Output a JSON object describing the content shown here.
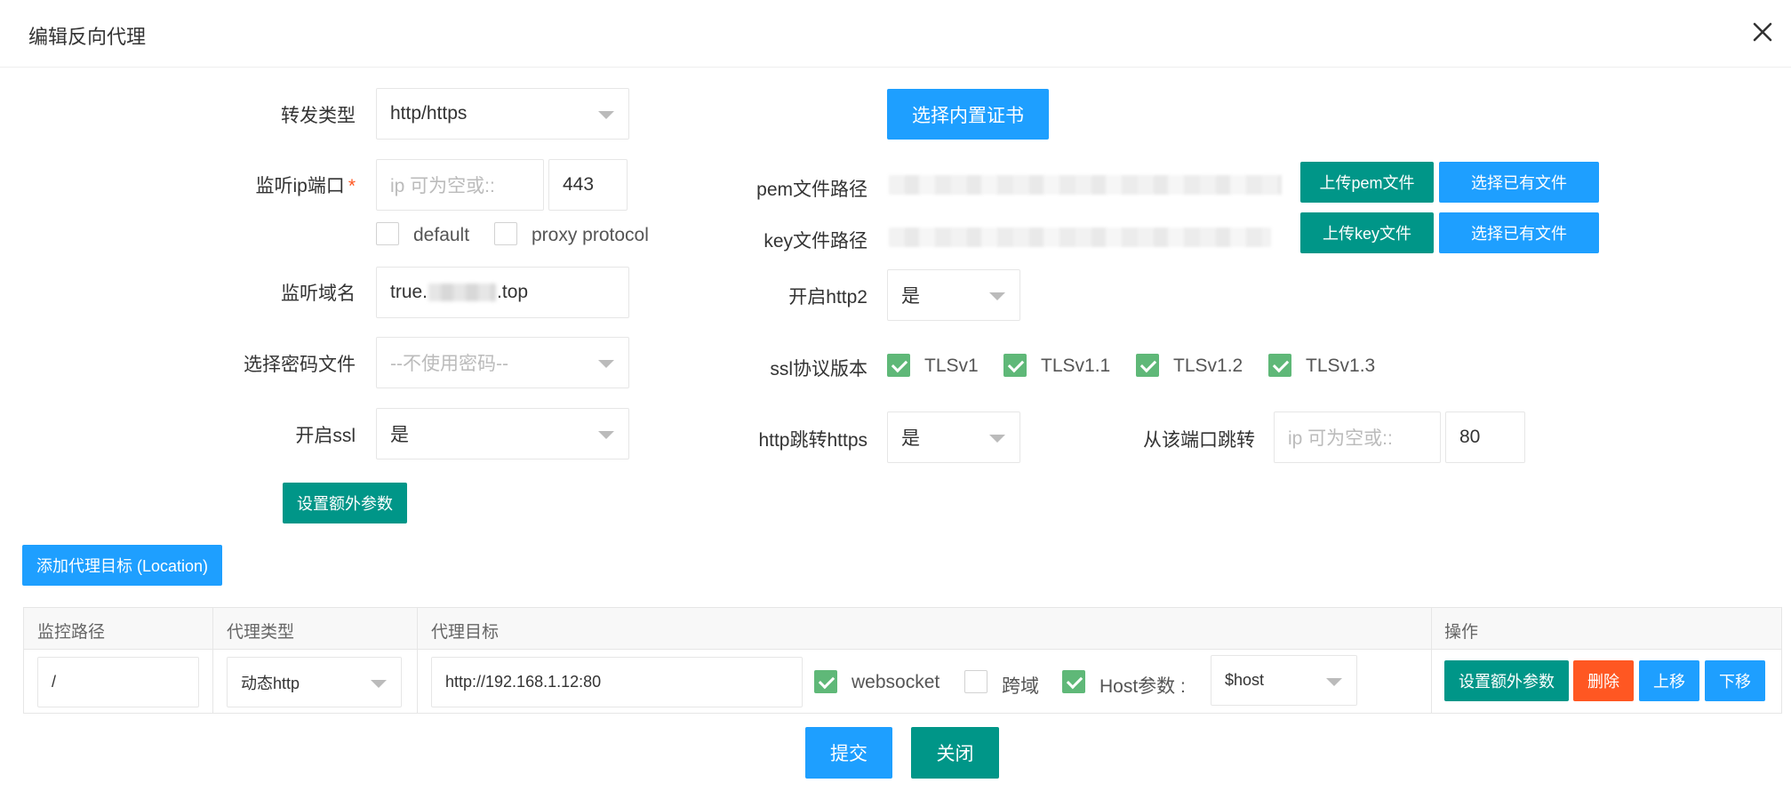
{
  "dialog": {
    "title": "编辑反向代理"
  },
  "form_left": {
    "forward_type": {
      "label": "转发类型",
      "value": "http/https"
    },
    "listen_ip_port": {
      "label": "监听ip端口",
      "required_mark": "*",
      "ip_placeholder": "ip 可为空或::",
      "port_value": "443"
    },
    "options": {
      "default_label": "default",
      "default_checked": false,
      "proxy_protocol_label": "proxy protocol",
      "proxy_protocol_checked": false
    },
    "listen_domain": {
      "label": "监听域名",
      "value_prefix": "true.",
      "value_suffix": ".top"
    },
    "password_file": {
      "label": "选择密码文件",
      "placeholder": "--不使用密码--"
    },
    "enable_ssl": {
      "label": "开启ssl",
      "value": "是"
    },
    "extra_params_button": "设置额外参数"
  },
  "form_right": {
    "choose_builtin_cert_button": "选择内置证书",
    "pem_path": {
      "label": "pem文件路径",
      "upload_button": "上传pem文件",
      "choose_button": "选择已有文件"
    },
    "key_path": {
      "label": "key文件路径",
      "upload_button": "上传key文件",
      "choose_button": "选择已有文件"
    },
    "enable_http2": {
      "label": "开启http2",
      "value": "是"
    },
    "ssl_versions": {
      "label": "ssl协议版本",
      "items": [
        {
          "name": "TLSv1",
          "checked": true
        },
        {
          "name": "TLSv1.1",
          "checked": true
        },
        {
          "name": "TLSv1.2",
          "checked": true
        },
        {
          "name": "TLSv1.3",
          "checked": true
        }
      ]
    },
    "http_redirect_https": {
      "label": "http跳转https",
      "value": "是"
    },
    "redirect_from_port": {
      "label": "从该端口跳转",
      "ip_placeholder": "ip 可为空或::",
      "port_value": "80"
    }
  },
  "add_location_button": "添加代理目标 (Location)",
  "locations_table": {
    "columns": [
      "监控路径",
      "代理类型",
      "代理目标",
      "操作"
    ],
    "rows": [
      {
        "path": "/",
        "proxy_type": "动态http",
        "target": "http://192.168.1.12:80",
        "websocket_label": "websocket",
        "websocket_checked": true,
        "cors_label": "跨域",
        "cors_checked": false,
        "host_label": "Host参数 :",
        "host_checked": true,
        "host_value": "$host",
        "actions": {
          "extra": "设置额外参数",
          "delete": "删除",
          "up": "上移",
          "down": "下移"
        }
      }
    ]
  },
  "footer": {
    "submit": "提交",
    "close": "关闭"
  },
  "colors": {
    "primary_blue": "#1e9fff",
    "primary_green": "#009688",
    "danger_orange": "#ff5722",
    "check_green": "#5fb878"
  }
}
